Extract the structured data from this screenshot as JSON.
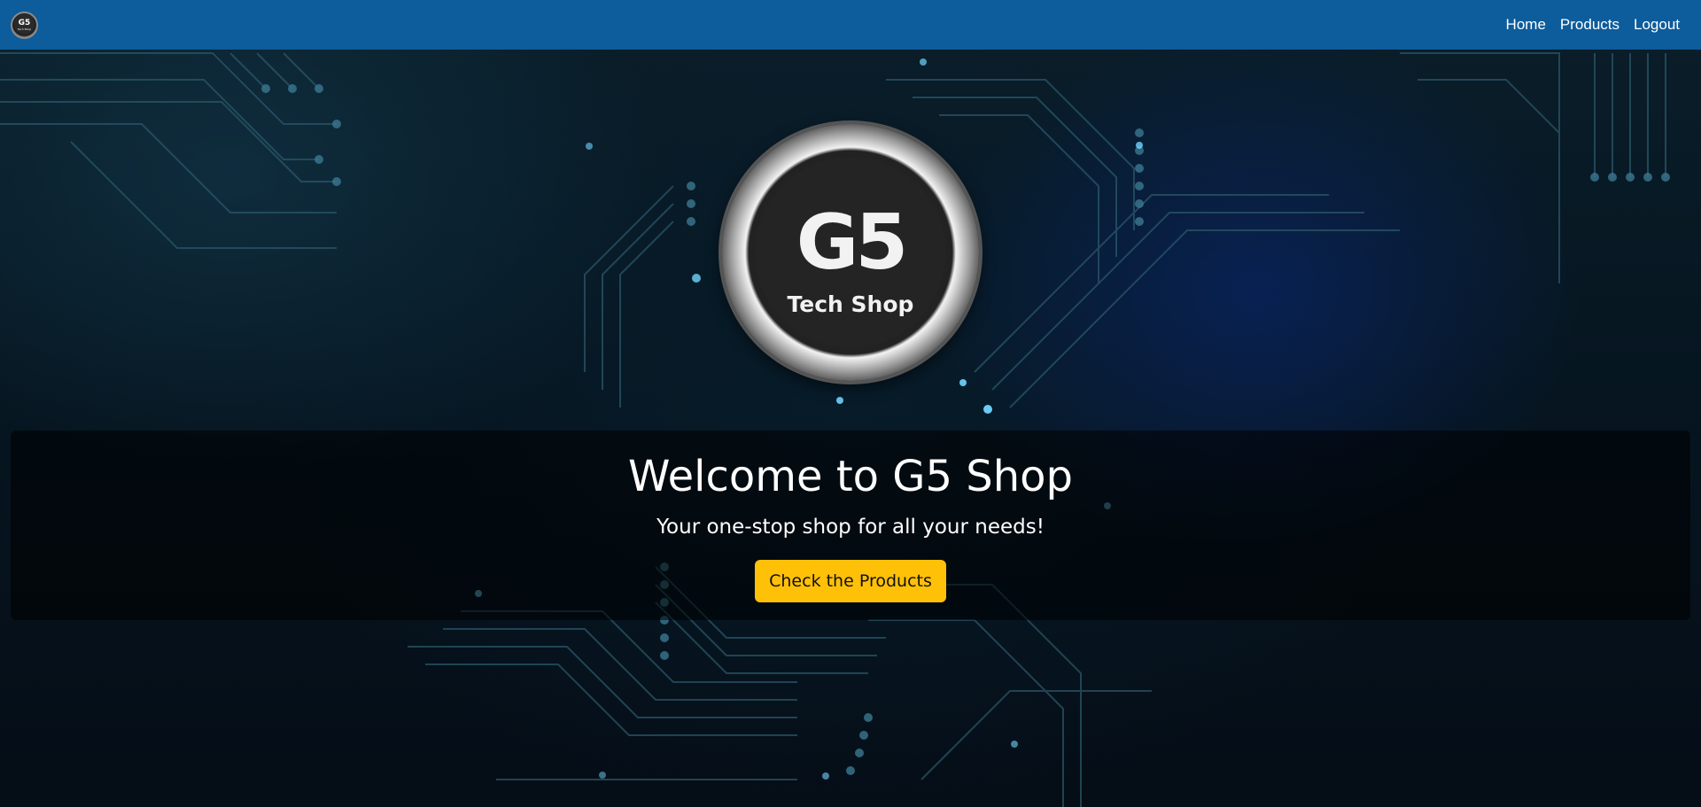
{
  "navbar": {
    "logo_text": "G5",
    "logo_subtext": "Tech Shop",
    "links": [
      {
        "label": "Home"
      },
      {
        "label": "Products"
      },
      {
        "label": "Logout"
      }
    ],
    "background_color": "#0d5c9b"
  },
  "hero": {
    "logo_text": "G5",
    "logo_subtext": "Tech Shop",
    "title": "Welcome to G5 Shop",
    "subtitle": "Your one-stop shop for all your needs!",
    "cta_label": "Check the Products",
    "cta_color": "#ffc107"
  }
}
